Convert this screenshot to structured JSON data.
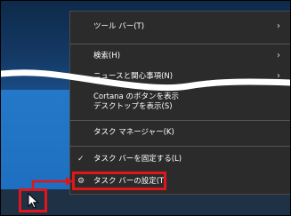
{
  "context_menu": {
    "items": [
      {
        "label": "ツール バー(T)",
        "submenu": true
      },
      {
        "label": "検索(H)",
        "submenu": true
      },
      {
        "label": "ニュースと関心事項(N)",
        "submenu": true
      },
      {
        "label": "Cortana のボタンを表示",
        "label2": "デスクトップを表示(S)"
      },
      {
        "label": "タスク マネージャー(K)"
      },
      {
        "label": "タスク バーを固定する(L)",
        "check": "✓"
      },
      {
        "label": "タスク バーの設定(T)",
        "icon": "gear-icon"
      }
    ],
    "submenu_glyph": "›",
    "gear_glyph": "⚙"
  },
  "colors": {
    "menu_bg": "#2b2b2b",
    "highlight": "#e0161d",
    "taskbar": "#1f3144",
    "desktop": "#2578c8"
  }
}
